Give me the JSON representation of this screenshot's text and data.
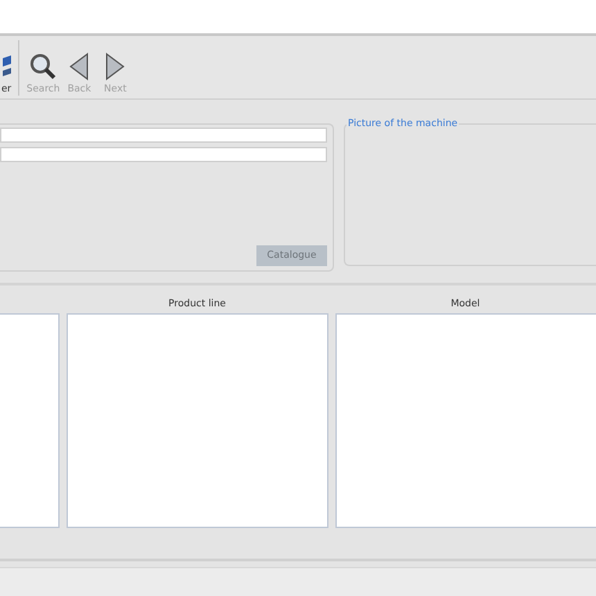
{
  "toolbar": [
    {
      "label": "er",
      "disabled": false,
      "kind": "edit"
    },
    {
      "label": "Search",
      "disabled": true,
      "kind": "search"
    },
    {
      "label": "Back",
      "disabled": true,
      "kind": "back"
    },
    {
      "label": "Next",
      "disabled": true,
      "kind": "next"
    }
  ],
  "details": {
    "fields": [
      {
        "kind": "text"
      },
      {
        "kind": "text"
      }
    ],
    "button": {
      "label": "Catalogue",
      "disabled": true
    }
  },
  "picture": {
    "title": "Picture of the machine"
  },
  "lists": [
    {
      "kind": "list"
    },
    {
      "kind": "list",
      "title": "Product line"
    },
    {
      "kind": "list",
      "title": "Model"
    }
  ]
}
